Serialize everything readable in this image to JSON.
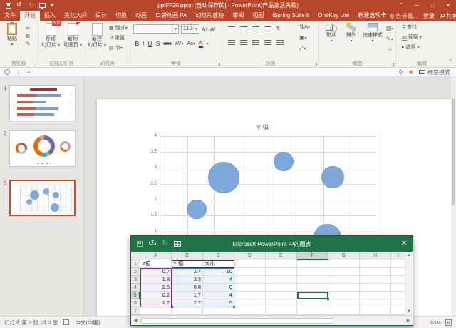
{
  "window": {
    "title": "pptFF20.pptm [自动保存的] - PowerPoint(产品激活失败)",
    "controls": [
      "ribbon-display-options",
      "minimize",
      "maximize",
      "close"
    ],
    "quick_access_icons": [
      "save",
      "undo",
      "redo",
      "start-slideshow",
      "customize-quick-access"
    ]
  },
  "tabs": {
    "items": [
      {
        "name": "file",
        "label": "文件"
      },
      {
        "name": "home",
        "label": "开始",
        "active": true
      },
      {
        "name": "insert",
        "label": "插入"
      },
      {
        "name": "docer",
        "label": "美化大师"
      },
      {
        "name": "design",
        "label": "设计"
      },
      {
        "name": "transitions",
        "label": "切换"
      },
      {
        "name": "animations",
        "label": "动画"
      },
      {
        "name": "pocket-animation",
        "label": "口袋动画 PA"
      },
      {
        "name": "slideshow",
        "label": "幻灯片放映"
      },
      {
        "name": "review",
        "label": "审阅"
      },
      {
        "name": "view",
        "label": "视图"
      },
      {
        "name": "ispring",
        "label": "iSpring Suite 8"
      },
      {
        "name": "onekey",
        "label": "OneKey Lite"
      },
      {
        "name": "new-tab",
        "label": "新建选项卡"
      }
    ],
    "tell_me": "告诉我...",
    "sign_in": "登录",
    "share": "共享"
  },
  "ribbon": {
    "clipboard": {
      "label": "剪贴板",
      "paste": "粘贴"
    },
    "online_slides": {
      "label": "在线幻灯片",
      "online_l1": "在线",
      "online_l2": "幻灯片",
      "hot_badge": "HOT",
      "anim_l1": "新加",
      "anim_l2": "动画页"
    },
    "slides": {
      "label": "幻灯片",
      "new_l1": "新建",
      "new_l2": "幻灯片",
      "layout": "版式",
      "reset": "重置",
      "section": "节"
    },
    "font": {
      "label": "字体",
      "size": "13.3"
    },
    "paragraph": {
      "label": "段落"
    },
    "drawing": {
      "label": "绘图",
      "shapes": "形状",
      "arrange": "排列",
      "quick_styles": "快速样式"
    },
    "editing": {
      "label": "编辑",
      "find": "查找",
      "replace": "替换",
      "select": "选择"
    }
  },
  "plugin_bar": {
    "label_mode": "标签模式"
  },
  "slide_panel": {
    "slides": [
      {
        "num": "1",
        "kind": "bar-chart"
      },
      {
        "num": "2",
        "kind": "donut-chart"
      },
      {
        "num": "3",
        "kind": "bubble-chart",
        "selected": true
      }
    ]
  },
  "chart_data": {
    "type": "bubble",
    "title": "Y 值",
    "points": [
      {
        "x": 0.7,
        "y": 2.7,
        "size": 10
      },
      {
        "x": 1.8,
        "y": 3.2,
        "size": 4
      },
      {
        "x": 2.6,
        "y": 0.8,
        "size": 8
      },
      {
        "x": 0.2,
        "y": 1.7,
        "size": 4
      },
      {
        "x": 2.7,
        "y": 2.7,
        "size": 5
      }
    ],
    "y_ticks_visible": [
      "4",
      "3.5",
      "3",
      "2.5",
      "2",
      "1.5",
      "1"
    ],
    "xlim": [
      -0.5,
      3.5
    ],
    "ylim": [
      0,
      4
    ],
    "grid": true,
    "bubble_color": "#7FA9DA"
  },
  "excel": {
    "title": "Microsoft PowerPoint 中的图表",
    "columns": [
      "A",
      "B",
      "C",
      "D",
      "E",
      "F",
      "G",
      "H",
      "I"
    ],
    "row_numbers": [
      "1",
      "2",
      "3",
      "4",
      "5",
      "6",
      "7"
    ],
    "rows": [
      [
        "X值",
        "Y 值",
        "大小"
      ],
      [
        "0.7",
        "2.7",
        "10"
      ],
      [
        "1.8",
        "3.2",
        "4"
      ],
      [
        "2.6",
        "0.8",
        "8"
      ],
      [
        "0.2",
        "1.7",
        "4"
      ],
      [
        "2.7",
        "2.7",
        "5"
      ],
      [
        "",
        "",
        ""
      ]
    ],
    "selected_cell": "F5",
    "selected_column": "F",
    "selected_row": "5"
  },
  "status_bar": {
    "slide_info": "幻灯片 第 3 张, 共 3 张",
    "language": "中文(中国)",
    "zoom_level": "63%"
  },
  "colors": {
    "app_accent": "#B7472A",
    "excel_accent": "#217346",
    "bubble": "#7FA9DA",
    "selection_border": "#D04A26",
    "range_category": "#7030A0",
    "range_values": "#4472C4",
    "range_names": "#C00000"
  }
}
